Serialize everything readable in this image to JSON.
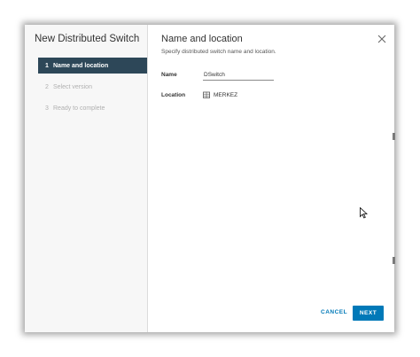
{
  "wizard": {
    "title": "New Distributed Switch",
    "steps": [
      {
        "number": "1",
        "label": "Name and location",
        "state": "active"
      },
      {
        "number": "2",
        "label": "Select version",
        "state": "pending"
      },
      {
        "number": "3",
        "label": "Ready to complete",
        "state": "pending"
      }
    ]
  },
  "page": {
    "title": "Name and location",
    "subtitle": "Specify distributed switch name and location.",
    "name_label": "Name",
    "name_value": "DSwitch",
    "location_label": "Location",
    "location_icon": "datacenter-icon",
    "location_value": "MERKEZ"
  },
  "footer": {
    "cancel_label": "CANCEL",
    "next_label": "NEXT"
  },
  "colors": {
    "active_step_bg": "#2d4758",
    "primary_button": "#0079b8",
    "link_text": "#0079b8"
  }
}
